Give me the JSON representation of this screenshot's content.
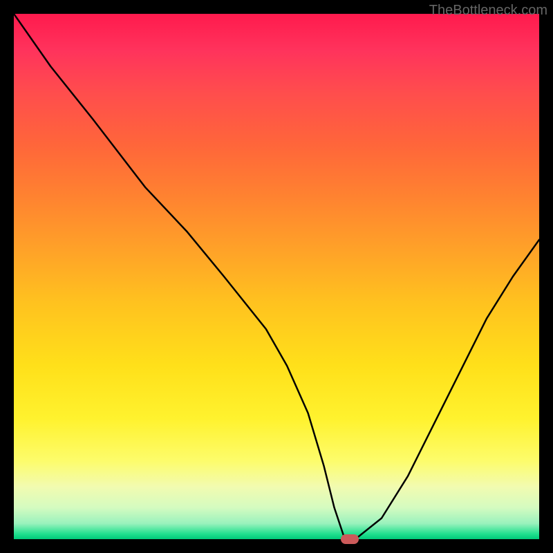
{
  "watermark": "TheBottleneck.com",
  "chart_data": {
    "type": "line",
    "x": [
      0,
      7,
      15,
      25,
      33,
      40,
      48,
      52,
      56,
      59,
      61,
      63,
      65,
      70,
      75,
      80,
      85,
      90,
      95,
      100
    ],
    "values": [
      100,
      90,
      80,
      67,
      58.5,
      50,
      40,
      33,
      24,
      14,
      6,
      0,
      0,
      4,
      12,
      22,
      32,
      42,
      50,
      57
    ],
    "title": "",
    "xlabel": "",
    "ylabel": "",
    "xlim": [
      0,
      100
    ],
    "ylim": [
      0,
      100
    ],
    "marker": {
      "x": 64,
      "y": 0
    },
    "background": "rainbow-gradient-red-to-green",
    "frame_color": "#000000",
    "line_color": "#000000",
    "notes": "V-shaped bottleneck curve with minimum near x≈64%; left segment has slope change around x≈25."
  }
}
